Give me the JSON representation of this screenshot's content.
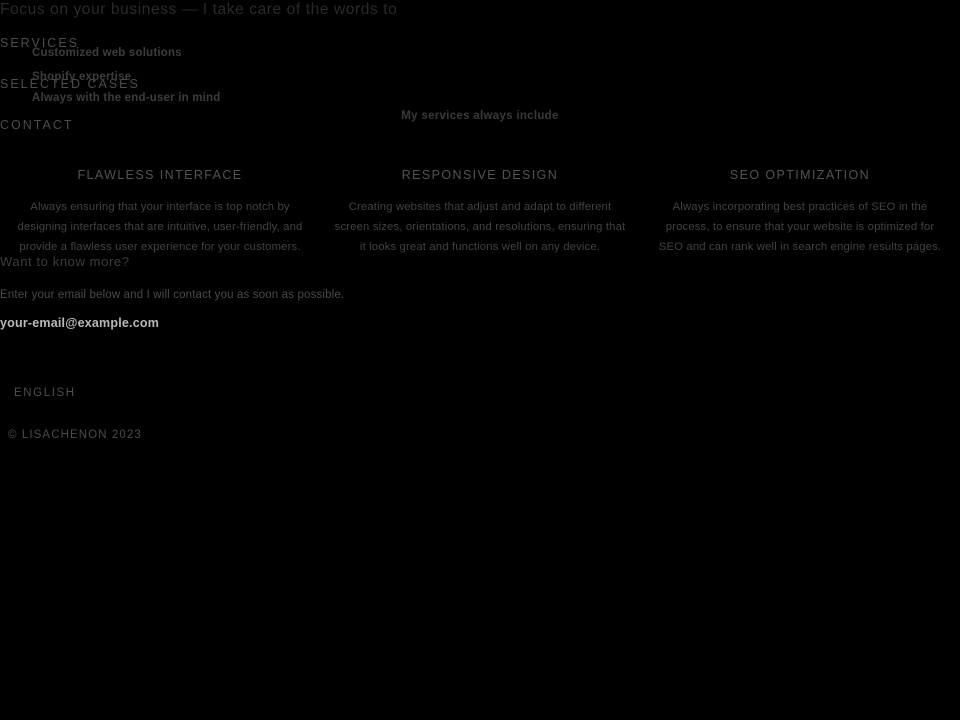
{
  "theme": {
    "background": "#000000",
    "dim_text": "#3d3d3d",
    "nav_text": "#4d4d4d",
    "bright_text": "#b9b9b9"
  },
  "hero": {
    "tagline": "Focus on your business — I take care of the words to"
  },
  "nav": {
    "items": [
      {
        "label": "SERVICES",
        "name": "nav-item-services"
      },
      {
        "label": "SELECTED CASES",
        "name": "nav-item-selected-cases"
      },
      {
        "label": "CONTACT",
        "name": "nav-item-contact"
      }
    ]
  },
  "rotating_taglines": {
    "line1": "Customized web solutions",
    "line2": "Shopify expertise",
    "line3": "Always with the end-user in mind"
  },
  "services": {
    "heading": "My services always include",
    "columns": [
      {
        "title": "FLAWLESS INTERFACE",
        "body": "Always ensuring that your interface is top notch by designing interfaces that are intuitive, user-friendly, and provide a flawless user experience for your customers."
      },
      {
        "title": "RESPONSIVE DESIGN",
        "body": "Creating websites that adjust and adapt to different screen sizes, orientations, and resolutions, ensuring that it looks great and functions well on any device."
      },
      {
        "title": "SEO OPTIMIZATION",
        "body": "Always incorporating best practices of SEO in the process, to ensure that your website is optimized for SEO and can rank well in search engine results pages."
      }
    ]
  },
  "contact": {
    "heading": "Want to know more?",
    "subtext": "Enter your email below and I will contact you as soon as possible.",
    "email_placeholder": "your-email@example.com",
    "email_value": ""
  },
  "footer": {
    "language": "ENGLISH",
    "copyright": "© LISACHENON 2023"
  }
}
